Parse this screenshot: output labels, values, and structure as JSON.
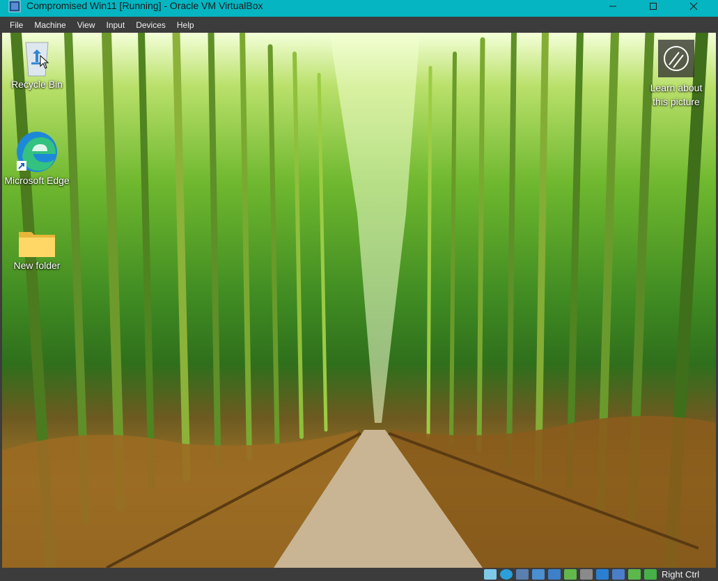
{
  "window": {
    "title": "Compromised Win11 [Running] - Oracle VM VirtualBox"
  },
  "menu": [
    "File",
    "Machine",
    "View",
    "Input",
    "Devices",
    "Help"
  ],
  "desktop_icons": [
    {
      "label": "Recycle Bin",
      "icon": "recycle-bin-icon"
    },
    {
      "label": "Microsoft Edge",
      "icon": "edge-icon"
    },
    {
      "label": "New folder",
      "icon": "folder-icon"
    }
  ],
  "learn": {
    "line1": "Learn about",
    "line2": "this picture",
    "icon": "camera-lens-icon"
  },
  "statusbar": {
    "host_key": "Right Ctrl",
    "indicators": [
      "hard-disk-icon",
      "optical-drive-icon",
      "audio-icon",
      "network-icon",
      "usb-icon",
      "shared-folders-icon",
      "display-icon",
      "video-capture-icon",
      "mouse-integration-icon",
      "cpu-icon",
      "keyboard-icon"
    ]
  },
  "colors": {
    "titlebar": "#05b5c1",
    "chrome": "#3c3c3c"
  }
}
